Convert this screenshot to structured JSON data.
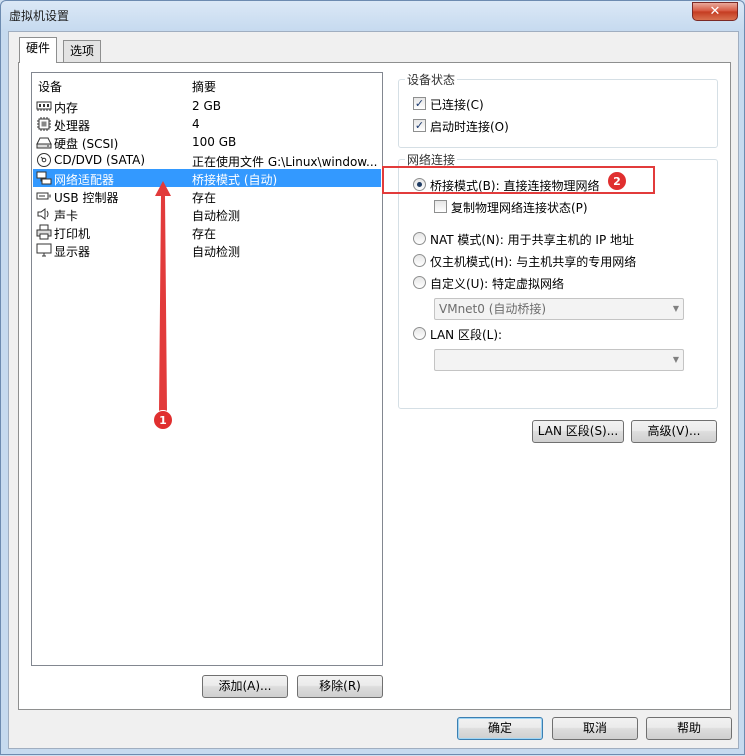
{
  "window": {
    "title": "虚拟机设置",
    "close_label": "✕"
  },
  "tabs": [
    {
      "label": "硬件"
    },
    {
      "label": "选项"
    }
  ],
  "device_list": {
    "headers": {
      "device": "设备",
      "summary": "摘要"
    },
    "rows": [
      {
        "name": "内存",
        "summary": "2 GB",
        "icon": "memory-icon"
      },
      {
        "name": "处理器",
        "summary": "4",
        "icon": "processor-icon"
      },
      {
        "name": "硬盘 (SCSI)",
        "summary": "100 GB",
        "icon": "hard-disk-icon"
      },
      {
        "name": "CD/DVD (SATA)",
        "summary": "正在使用文件 G:\\Linux\\window...",
        "icon": "cd-dvd-icon"
      },
      {
        "name": "网络适配器",
        "summary": "桥接模式 (自动)",
        "icon": "network-adapter-icon",
        "selected": true
      },
      {
        "name": "USB 控制器",
        "summary": "存在",
        "icon": "usb-icon"
      },
      {
        "name": "声卡",
        "summary": "自动检测",
        "icon": "speaker-icon"
      },
      {
        "name": "打印机",
        "summary": "存在",
        "icon": "printer-icon"
      },
      {
        "name": "显示器",
        "summary": "自动检测",
        "icon": "monitor-icon"
      }
    ]
  },
  "buttons": {
    "add": "添加(A)...",
    "remove": "移除(R)",
    "lan_segments": "LAN 区段(S)...",
    "advanced": "高级(V)...",
    "ok": "确定",
    "cancel": "取消",
    "help": "帮助"
  },
  "device_status": {
    "title": "设备状态",
    "connected": {
      "label": "已连接(C)",
      "checked": true
    },
    "connect_at_power_on": {
      "label": "启动时连接(O)",
      "checked": true
    }
  },
  "network_connection": {
    "title": "网络连接",
    "bridged": {
      "label": "桥接模式(B): 直接连接物理网络",
      "checked": true
    },
    "replicate_state": {
      "label": "复制物理网络连接状态(P)",
      "checked": false
    },
    "nat": {
      "label": "NAT 模式(N): 用于共享主机的 IP 地址",
      "checked": false
    },
    "host_only": {
      "label": "仅主机模式(H): 与主机共享的专用网络",
      "checked": false
    },
    "custom": {
      "label": "自定义(U): 特定虚拟网络",
      "checked": false
    },
    "custom_select_value": "VMnet0 (自动桥接)",
    "lan_segment": {
      "label": "LAN 区段(L):",
      "checked": false
    },
    "lan_segment_select_value": ""
  },
  "annotations": {
    "badge_1": "1",
    "badge_2": "2"
  },
  "colors": {
    "annotation_red": "#e23b3b",
    "selection_blue": "#3399ff"
  }
}
